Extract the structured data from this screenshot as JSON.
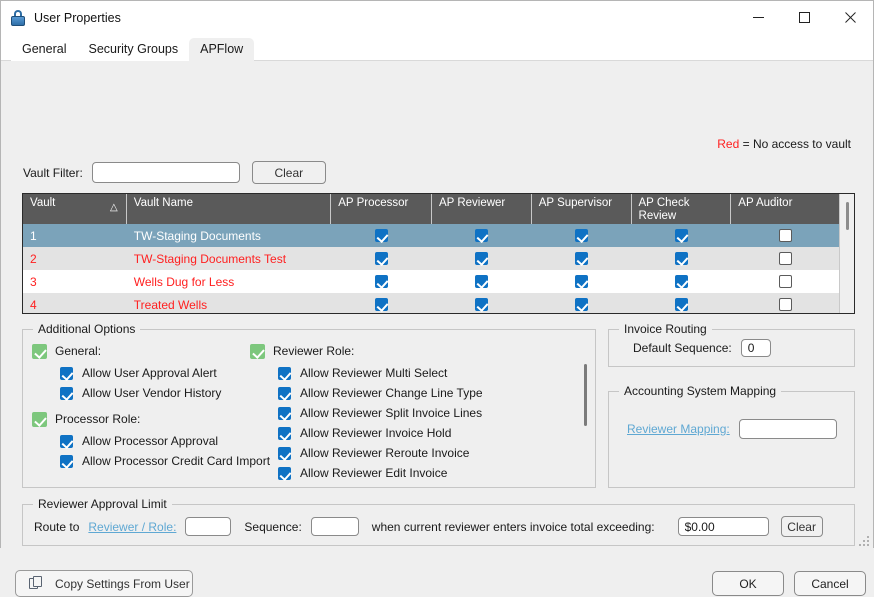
{
  "window": {
    "title": "User Properties",
    "icon": "lock-icon",
    "controls": {
      "minimize": "—",
      "maximize": "□",
      "close": "✕"
    }
  },
  "tabs": [
    {
      "label": "General",
      "active": false
    },
    {
      "label": "Security Groups",
      "active": false
    },
    {
      "label": "APFlow",
      "active": true
    }
  ],
  "legend": {
    "red_word": "Red",
    "text": "= No access to vault"
  },
  "vault_filter": {
    "label": "Vault Filter:",
    "value": "",
    "placeholder": "",
    "clear_label": "Clear"
  },
  "grid": {
    "columns": [
      {
        "key": "vault",
        "label": "Vault",
        "sort": "△"
      },
      {
        "key": "vault_name",
        "label": "Vault Name"
      },
      {
        "key": "ap_processor",
        "label": "AP Processor"
      },
      {
        "key": "ap_reviewer",
        "label": "AP Reviewer"
      },
      {
        "key": "ap_supervisor",
        "label": "AP Supervisor"
      },
      {
        "key": "ap_check_review",
        "label": "AP Check Review"
      },
      {
        "key": "ap_auditor",
        "label": "AP Auditor"
      }
    ],
    "rows": [
      {
        "vault": "1",
        "vault_name": "TW-Staging Documents",
        "ap_processor": true,
        "ap_reviewer": true,
        "ap_supervisor": true,
        "ap_check_review": true,
        "ap_auditor": false,
        "selected": true,
        "no_access": false
      },
      {
        "vault": "2",
        "vault_name": "TW-Staging Documents Test",
        "ap_processor": true,
        "ap_reviewer": true,
        "ap_supervisor": true,
        "ap_check_review": true,
        "ap_auditor": false,
        "selected": false,
        "no_access": true
      },
      {
        "vault": "3",
        "vault_name": "Wells Dug for Less",
        "ap_processor": true,
        "ap_reviewer": true,
        "ap_supervisor": true,
        "ap_check_review": true,
        "ap_auditor": false,
        "selected": false,
        "no_access": true
      },
      {
        "vault": "4",
        "vault_name": "Treated Wells",
        "ap_processor": true,
        "ap_reviewer": true,
        "ap_supervisor": true,
        "ap_check_review": true,
        "ap_auditor": false,
        "selected": false,
        "no_access": true
      }
    ]
  },
  "additional_options": {
    "caption": "Additional Options",
    "left": [
      {
        "label": "General:",
        "checked": true,
        "style": "green",
        "sub": false
      },
      {
        "label": "Allow User Approval Alert",
        "checked": true,
        "style": "blue",
        "sub": true
      },
      {
        "label": "Allow User Vendor History",
        "checked": true,
        "style": "blue",
        "sub": true
      },
      {
        "label": "Processor Role:",
        "checked": true,
        "style": "green",
        "sub": false
      },
      {
        "label": "Allow Processor Approval",
        "checked": true,
        "style": "blue",
        "sub": true
      },
      {
        "label": "Allow Processor Credit Card Import",
        "checked": true,
        "style": "blue",
        "sub": true
      }
    ],
    "right": [
      {
        "label": "Reviewer Role:",
        "checked": true,
        "style": "green",
        "sub": false
      },
      {
        "label": "Allow Reviewer Multi Select",
        "checked": true,
        "style": "blue",
        "sub": true
      },
      {
        "label": "Allow Reviewer Change Line Type",
        "checked": true,
        "style": "blue",
        "sub": true
      },
      {
        "label": "Allow Reviewer Split Invoice Lines",
        "checked": true,
        "style": "blue",
        "sub": true
      },
      {
        "label": "Allow Reviewer Invoice Hold",
        "checked": true,
        "style": "blue",
        "sub": true
      },
      {
        "label": "Allow Reviewer Reroute Invoice",
        "checked": true,
        "style": "blue",
        "sub": true
      },
      {
        "label": "Allow Reviewer Edit Invoice",
        "checked": true,
        "style": "blue",
        "sub": true
      }
    ]
  },
  "invoice_routing": {
    "caption": "Invoice Routing",
    "default_sequence_label": "Default Sequence:",
    "default_sequence_value": "0"
  },
  "accounting_mapping": {
    "caption": "Accounting System Mapping",
    "reviewer_mapping_label": "Reviewer Mapping:",
    "reviewer_mapping_value": ""
  },
  "approval_limit": {
    "caption": "Reviewer Approval Limit",
    "route_to_label": "Route to",
    "reviewer_role_link": "Reviewer / Role:",
    "reviewer_role_value": "",
    "sequence_label": "Sequence:",
    "sequence_value": "",
    "condition_text": "when current reviewer enters invoice total exceeding:",
    "amount_value": "$0.00",
    "clear_label": "Clear"
  },
  "footer": {
    "copy_settings_label": "Copy Settings From User",
    "ok_label": "OK",
    "cancel_label": "Cancel"
  },
  "colors": {
    "selected_row": "#7ba3ba",
    "header_bg": "#5a5a5a",
    "no_access_red": "#ff2020",
    "checkbox_blue": "#0f72c4",
    "checkbox_green": "#7dc77d",
    "link_blue": "#5fa8d3"
  }
}
